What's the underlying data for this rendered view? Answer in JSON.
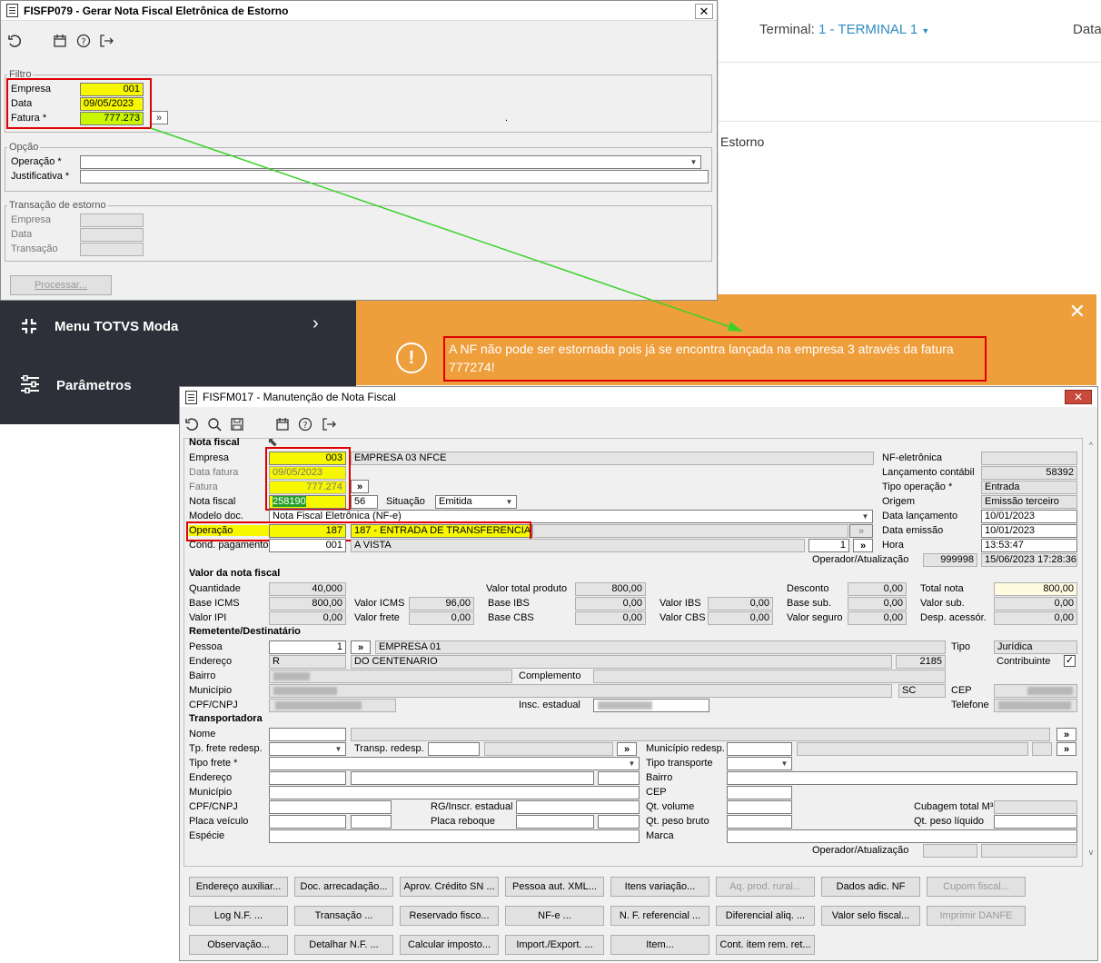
{
  "win1": {
    "title": "FISFP079 - Gerar Nota Fiscal Eletrônica de Estorno",
    "filtro": {
      "legend": "Filtro",
      "empresa_label": "Empresa",
      "empresa": "001",
      "data_label": "Data",
      "data": "09/05/2023",
      "fatura_label": "Fatura *",
      "fatura": "777.273",
      "dot": "."
    },
    "opcao": {
      "legend": "Opção",
      "operacao_label": "Operação *",
      "justificativa_label": "Justificativa *"
    },
    "transacao": {
      "legend": "Transação de estorno",
      "empresa_label": "Empresa",
      "data_label": "Data",
      "transacao_label": "Transação"
    },
    "process_btn": "Processar..."
  },
  "web": {
    "terminal_label": "Terminal:",
    "terminal_value": "1 - TERMINAL 1",
    "data_label": "Data",
    "estorno": "Estorno",
    "accent": "#2e8bc0"
  },
  "sidebar": {
    "menu_label": "Menu TOTVS Moda",
    "params_label": "Parâmetros",
    "bg": "#2d3038"
  },
  "toast": {
    "message": "A NF não pode ser estornada pois já se encontra lançada na empresa 3 através da fatura 777274!",
    "bg": "#ef9e3c"
  },
  "win2": {
    "title": "FISFM017 - Manutenção de Nota Fiscal",
    "nota": {
      "section": "Nota fiscal",
      "empresa_label": "Empresa",
      "empresa": "003",
      "empresa_nome": "EMPRESA 03 NFCE",
      "data_fatura_label": "Data fatura",
      "data_fatura": "09/05/2023",
      "fatura_label": "Fatura",
      "fatura": "777.274",
      "nota_label": "Nota fiscal",
      "nota": "258190",
      "serie": "56",
      "situacao_label": "Situação",
      "situacao": "Emitida",
      "modelo_label": "Modelo doc.",
      "modelo": "Nota Fiscal Eletrônica (NF-e)",
      "operacao_label": "Operação",
      "operacao": "187",
      "operacao_desc": "187 - ENTRADA DE TRANSFERENCIA",
      "cond_label": "Cond. pagamento",
      "cond": "001",
      "cond_desc": "A VISTA",
      "cond_num": "1",
      "nfe_label": "NF-eletrônica",
      "lanc_label": "Lançamento contábil",
      "lanc": "58392",
      "tipo_op_label": "Tipo operação *",
      "tipo_op": "Entrada",
      "origem_label": "Origem",
      "origem": "Emissão terceiro",
      "data_lanc_label": "Data lançamento",
      "data_lanc": "10/01/2023",
      "data_emis_label": "Data emissão",
      "data_emis": "10/01/2023",
      "hora_label": "Hora",
      "hora": "13:53:47",
      "oper_label": "Operador/Atualização",
      "oper": "999998",
      "oper_ts": "15/06/2023 17:28:36"
    },
    "valor": {
      "section": "Valor da nota fiscal",
      "quantidade_label": "Quantidade",
      "quantidade": "40,000",
      "base_icms_label": "Base ICMS",
      "base_icms": "800,00",
      "valor_ipi_label": "Valor IPI",
      "valor_ipi": "0,00",
      "valor_icms_label": "Valor ICMS",
      "valor_icms": "96,00",
      "valor_frete_label": "Valor frete",
      "valor_frete": "0,00",
      "vtp_label": "Valor total produto",
      "vtp": "800,00",
      "base_ibs_label": "Base IBS",
      "base_ibs": "0,00",
      "base_cbs_label": "Base CBS",
      "base_cbs": "0,00",
      "valor_ibs_label": "Valor IBS",
      "valor_ibs": "0,00",
      "valor_cbs_label": "Valor CBS",
      "valor_cbs": "0,00",
      "desconto_label": "Desconto",
      "desconto": "0,00",
      "base_sub_label": "Base sub.",
      "base_sub": "0,00",
      "valor_seguro_label": "Valor seguro",
      "valor_seguro": "0,00",
      "total_label": "Total nota",
      "total": "800,00",
      "valor_sub_label": "Valor sub.",
      "valor_sub": "0,00",
      "desp_label": "Desp. acessór.",
      "desp": "0,00"
    },
    "rem": {
      "section": "Remetente/Destinatário",
      "pessoa_label": "Pessoa",
      "pessoa": "1",
      "pessoa_nome": "EMPRESA 01",
      "tipo_label": "Tipo",
      "tipo": "Jurídica",
      "endereco_label": "Endereço",
      "endereco_tipo": "R",
      "endereco": "DO CENTENARIO",
      "numero": "2185",
      "contribuinte_label": "Contribuinte",
      "bairro_label": "Bairro",
      "complemento_label": "Complemento",
      "municipio_label": "Município",
      "uf": "SC",
      "cep_label": "CEP",
      "cpf_label": "CPF/CNPJ",
      "insc_label": "Insc. estadual",
      "telefone_label": "Telefone"
    },
    "transp": {
      "section": "Transportadora",
      "nome_label": "Nome",
      "tp_frete_label": "Tp. frete redesp.",
      "transp_redesp_label": "Transp. redesp.",
      "mun_redesp_label": "Município redesp.",
      "tipo_frete_label": "Tipo frete *",
      "tipo_transp_label": "Tipo transporte",
      "endereco_label": "Endereço",
      "bairro_label": "Bairro",
      "municipio_label": "Município",
      "cep_label": "CEP",
      "cpf_label": "CPF/CNPJ",
      "rg_label": "RG/Inscr. estadual",
      "qt_volume_label": "Qt. volume",
      "cubagem_label": "Cubagem total M³",
      "placa_label": "Placa veículo",
      "placa_reb_label": "Placa reboque",
      "peso_bruto_label": "Qt. peso bruto",
      "peso_liq_label": "Qt. peso líquido",
      "especie_label": "Espécie",
      "marca_label": "Marca",
      "oper_label": "Operador/Atualização"
    },
    "buttons": [
      [
        "Endereço auxiliar...",
        "Doc. arrecadação...",
        "Aprov. Crédito SN ...",
        "Pessoa aut. XML...",
        "Itens variação...",
        "Aq. prod. rural...",
        "Dados adic. NF",
        "Cupom fiscal..."
      ],
      [
        "Log N.F. ...",
        "Transação ...",
        "Reservado fisco...",
        "NF-e ...",
        "N. F. referencial ...",
        "Diferencial aliq. ...",
        "Valor selo fiscal...",
        "Imprimir DANFE"
      ],
      [
        "Observação...",
        "Detalhar N.F. ...",
        "Calcular imposto...",
        "Import./Export. ...",
        "Item...",
        "Cont. item rem. ret..."
      ]
    ]
  }
}
